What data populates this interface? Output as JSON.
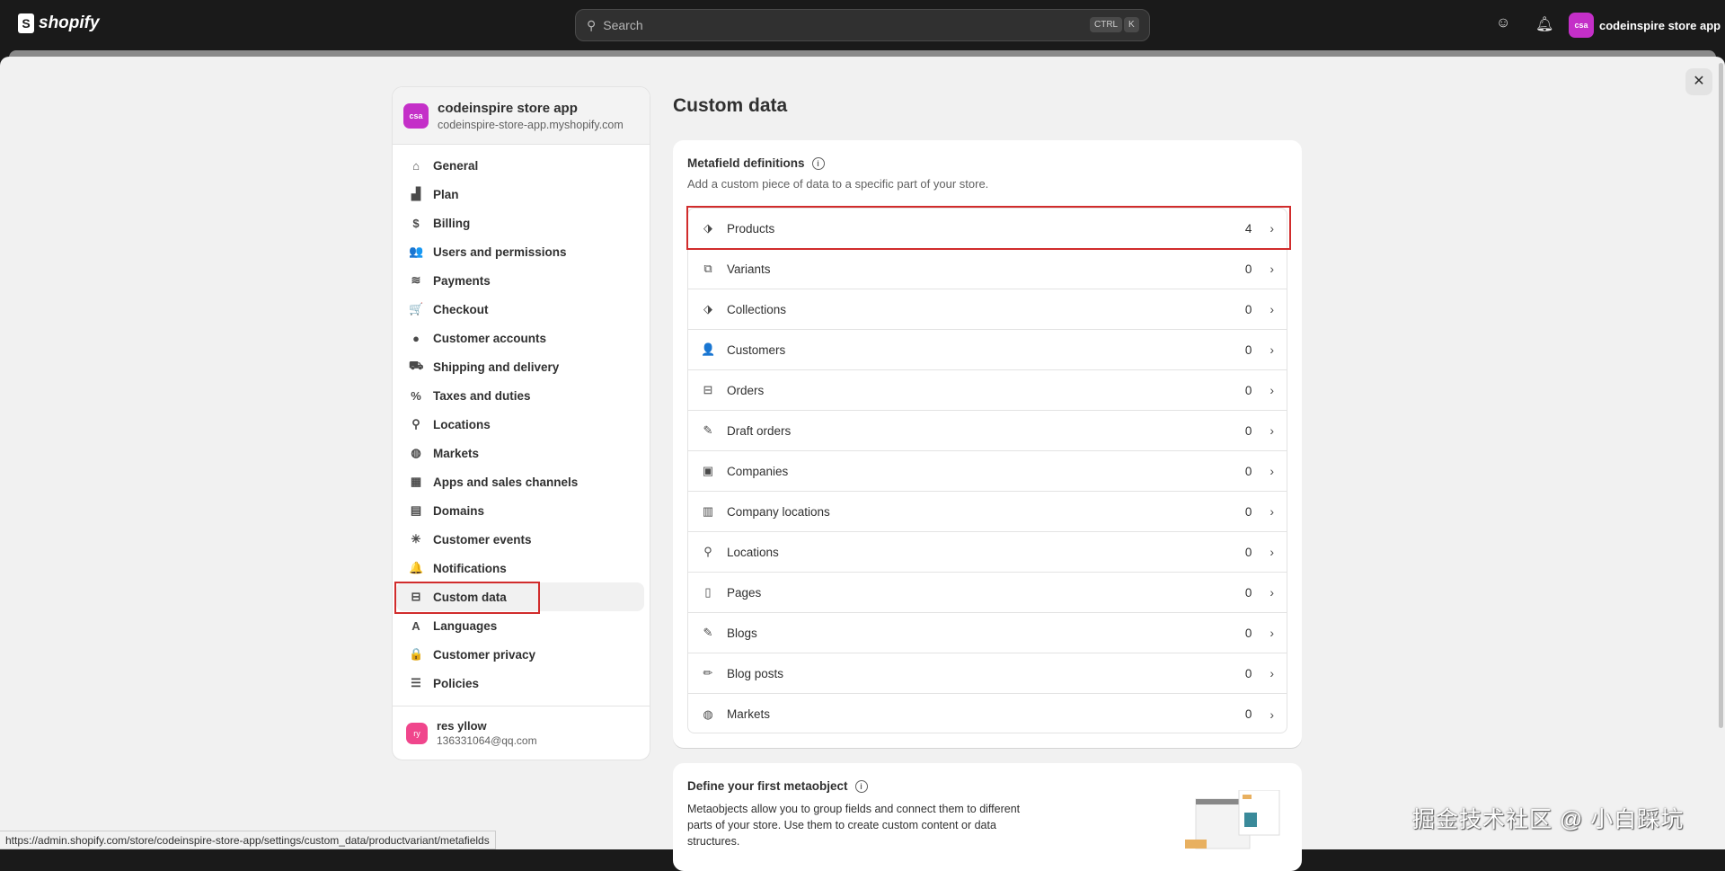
{
  "topbar": {
    "logo": "shopify",
    "search_placeholder": "Search",
    "kbd1": "CTRL",
    "kbd2": "K",
    "store_initials": "csa",
    "store_name": "codeinspire store app"
  },
  "sidebar": {
    "store_name": "codeinspire store app",
    "store_url": "codeinspire-store-app.myshopify.com",
    "store_initials": "csa",
    "items": [
      {
        "label": "General",
        "icon": "⌂"
      },
      {
        "label": "Plan",
        "icon": "▟"
      },
      {
        "label": "Billing",
        "icon": "$"
      },
      {
        "label": "Users and permissions",
        "icon": "👥"
      },
      {
        "label": "Payments",
        "icon": "≋"
      },
      {
        "label": "Checkout",
        "icon": "🛒"
      },
      {
        "label": "Customer accounts",
        "icon": "●"
      },
      {
        "label": "Shipping and delivery",
        "icon": "⛟"
      },
      {
        "label": "Taxes and duties",
        "icon": "%"
      },
      {
        "label": "Locations",
        "icon": "⚲"
      },
      {
        "label": "Markets",
        "icon": "◍"
      },
      {
        "label": "Apps and sales channels",
        "icon": "▦"
      },
      {
        "label": "Domains",
        "icon": "▤"
      },
      {
        "label": "Customer events",
        "icon": "✳"
      },
      {
        "label": "Notifications",
        "icon": "🔔"
      },
      {
        "label": "Custom data",
        "icon": "⊟"
      },
      {
        "label": "Languages",
        "icon": "A"
      },
      {
        "label": "Customer privacy",
        "icon": "🔒"
      },
      {
        "label": "Policies",
        "icon": "☰"
      }
    ],
    "active": "Custom data",
    "user": {
      "initials": "ry",
      "name": "res yllow",
      "email": "136331064@qq.com"
    }
  },
  "main": {
    "title": "Custom data",
    "metafields": {
      "heading": "Metafield definitions",
      "info": "i",
      "subtitle": "Add a custom piece of data to a specific part of your store.",
      "rows": [
        {
          "label": "Products",
          "count": "4",
          "icon": "⬗"
        },
        {
          "label": "Variants",
          "count": "0",
          "icon": "⧉"
        },
        {
          "label": "Collections",
          "count": "0",
          "icon": "⬗"
        },
        {
          "label": "Customers",
          "count": "0",
          "icon": "👤"
        },
        {
          "label": "Orders",
          "count": "0",
          "icon": "⊟"
        },
        {
          "label": "Draft orders",
          "count": "0",
          "icon": "✎"
        },
        {
          "label": "Companies",
          "count": "0",
          "icon": "▣"
        },
        {
          "label": "Company locations",
          "count": "0",
          "icon": "▥"
        },
        {
          "label": "Locations",
          "count": "0",
          "icon": "⚲"
        },
        {
          "label": "Pages",
          "count": "0",
          "icon": "▯"
        },
        {
          "label": "Blogs",
          "count": "0",
          "icon": "✎"
        },
        {
          "label": "Blog posts",
          "count": "0",
          "icon": "✏"
        },
        {
          "label": "Markets",
          "count": "0",
          "icon": "◍"
        }
      ]
    },
    "metaobject": {
      "heading": "Define your first metaobject",
      "info": "i",
      "body": "Metaobjects allow you to group fields and connect them to different parts of your store. Use them to create custom content or data structures."
    }
  },
  "statusbar": "https://admin.shopify.com/store/codeinspire-store-app/settings/custom_data/productvariant/metafields",
  "watermark": "掘金技术社区 @ 小白踩坑"
}
